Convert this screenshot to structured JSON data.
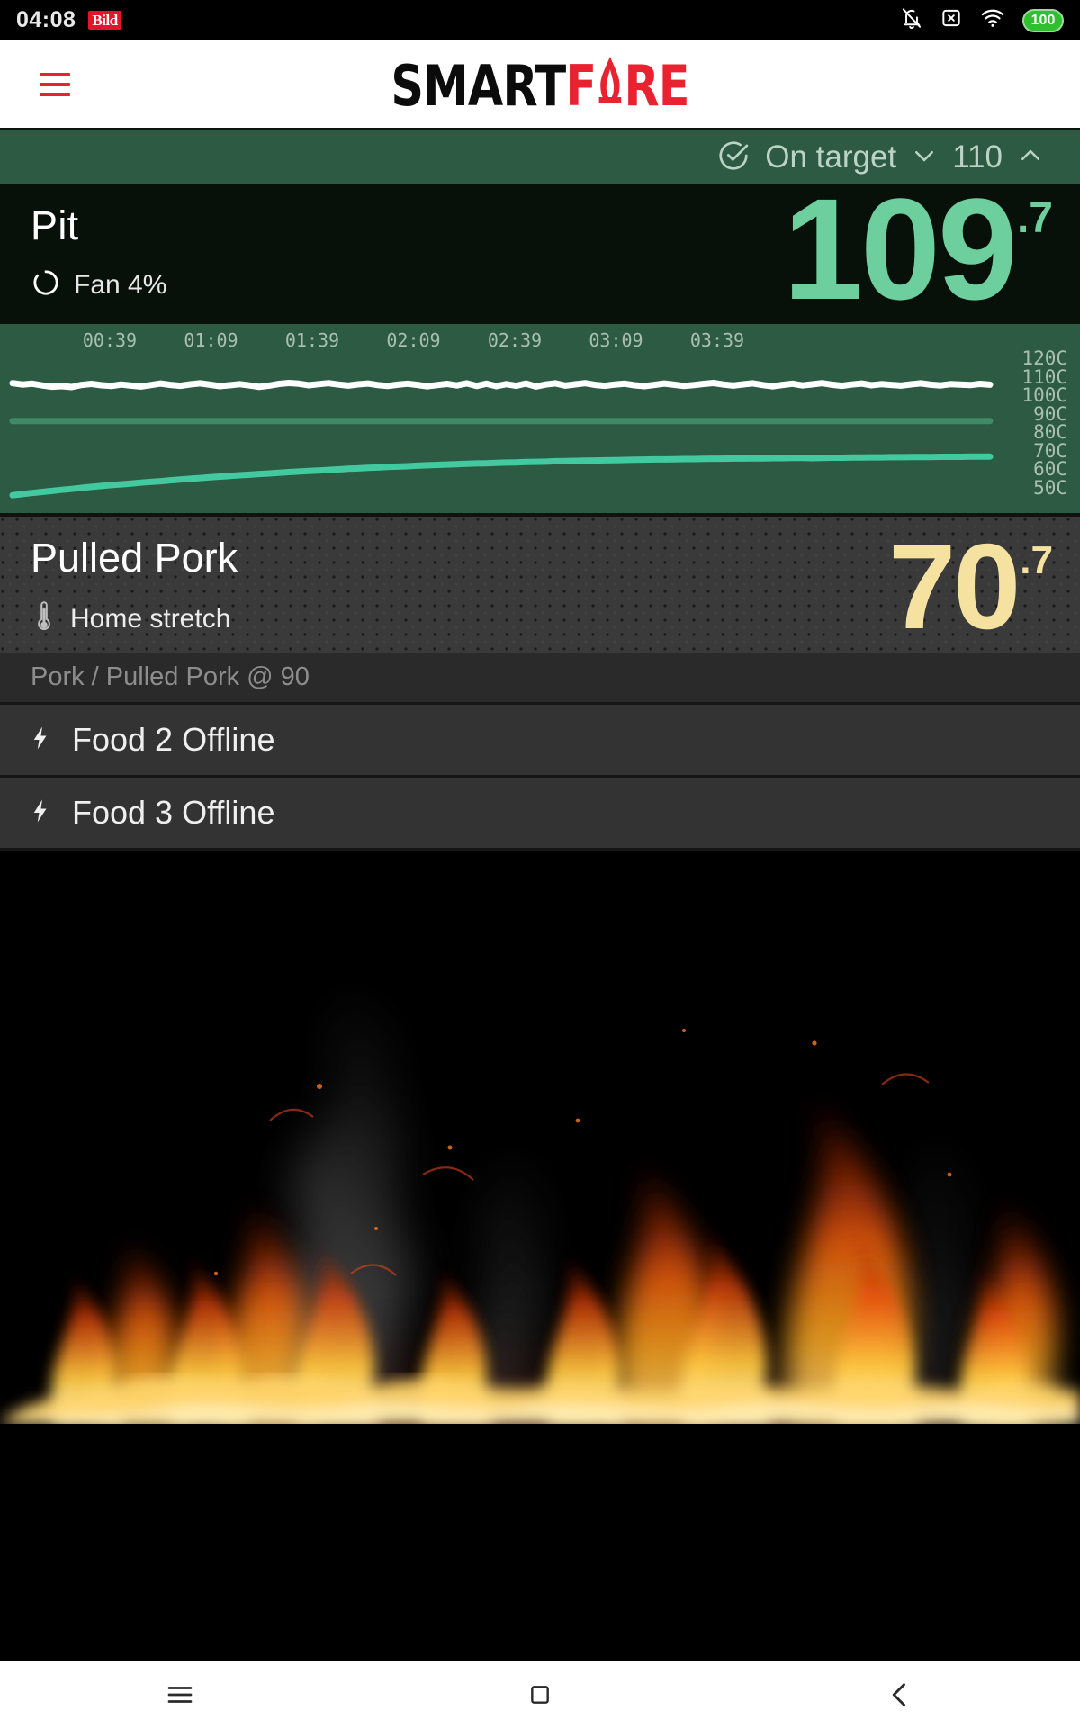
{
  "statusbar": {
    "time": "04:08",
    "app_badge": "Bild",
    "battery": "100",
    "icons": [
      "bell-slash-icon",
      "sim-card-x-icon",
      "wifi-icon",
      "battery-icon"
    ]
  },
  "appbar": {
    "menu_icon": "hamburger-menu-icon",
    "logo_part1": "SMART",
    "logo_part2": "F",
    "logo_part3": "RE",
    "logo_full": "SMARTFIRE",
    "brand_red": "#e8222f",
    "brand_black": "#0b0b0b"
  },
  "target_strip": {
    "status_icon": "check-circle-icon",
    "status_label": "On target",
    "chevron_down": "chevron-down-icon",
    "target_value": "110",
    "chevron_up": "chevron-up-icon"
  },
  "pit": {
    "name": "Pit",
    "fan_icon": "fan-icon",
    "fan_label": "Fan 4%",
    "temp_whole": "109",
    "temp_decimal": ".7",
    "temp_color": "#6ecf9e"
  },
  "food": {
    "name": "Pulled Pork",
    "status_icon": "thermometer-icon",
    "status_label": "Home stretch",
    "temp_whole": "70",
    "temp_decimal": ".7",
    "temp_color": "#f6e2a0",
    "recipe": "Pork / Pulled Pork @ 90"
  },
  "probes": [
    {
      "icon": "bolt-icon",
      "label": "Food 2 Offline"
    },
    {
      "icon": "bolt-icon",
      "label": "Food 3 Offline"
    }
  ],
  "navbar": {
    "recents_icon": "recents-menu-icon",
    "home_icon": "home-square-icon",
    "back_icon": "back-chevron-icon"
  },
  "chart_data": {
    "type": "line",
    "title": "",
    "xlabel": "",
    "ylabel": "",
    "grid": false,
    "legend": false,
    "x_tick_labels": [
      "00:39",
      "01:09",
      "01:39",
      "02:09",
      "02:39",
      "03:09",
      "03:39"
    ],
    "y_tick_labels": [
      "120C",
      "110C",
      "100C",
      "90C",
      "80C",
      "70C",
      "60C",
      "50C"
    ],
    "ylim": [
      45,
      125
    ],
    "units": "C",
    "series": [
      {
        "name": "Pit probe",
        "color": "#ffffff",
        "values": [
          110.5,
          109.8,
          110.2,
          109.3,
          108.6,
          108.9,
          108.4,
          109.6,
          110.1,
          109.4,
          109.0,
          109.8,
          109.2,
          108.7,
          109.5,
          110.3,
          109.6,
          109.1,
          109.9,
          110.4,
          109.7,
          108.9,
          109.4,
          110.0,
          109.3,
          108.5,
          109.2,
          110.1,
          110.6,
          110.2,
          109.4,
          110.0,
          110.5,
          109.8,
          109.2,
          109.9,
          110.3,
          109.5,
          109.0,
          109.7,
          110.2,
          109.6,
          108.8,
          109.5,
          110.1,
          109.3,
          110.4,
          109.0,
          110.2,
          108.9,
          110.0,
          109.1,
          110.3,
          108.7,
          109.8,
          110.4,
          109.2,
          109.9,
          110.5,
          109.6,
          109.1,
          109.8,
          110.2,
          109.4,
          108.9,
          109.6,
          110.3,
          109.7,
          109.0,
          109.5,
          110.1,
          110.6,
          109.8,
          109.2,
          109.9,
          110.4,
          109.5,
          108.8,
          109.6,
          110.2,
          109.3,
          109.9,
          110.5,
          109.7,
          109.1,
          109.8,
          110.3,
          109.4,
          110.0,
          109.6,
          109.2,
          109.9,
          110.4,
          109.7,
          109.3,
          110.0,
          109.8,
          109.5,
          110.1,
          109.7
        ]
      },
      {
        "name": "Pit setpoint",
        "color": "#3f8b68",
        "constant": 90
      },
      {
        "name": "Food probe",
        "color": "#43c9a0",
        "values": [
          49.8,
          50.4,
          51.0,
          51.6,
          52.1,
          52.7,
          53.2,
          53.8,
          54.3,
          54.8,
          55.3,
          55.7,
          56.1,
          56.6,
          57.0,
          57.4,
          57.9,
          58.3,
          58.7,
          59.1,
          59.5,
          59.9,
          60.2,
          60.6,
          60.9,
          61.3,
          61.6,
          62.0,
          62.3,
          62.6,
          62.9,
          63.2,
          63.5,
          63.8,
          64.1,
          64.3,
          64.6,
          64.8,
          65.1,
          65.3,
          65.5,
          65.8,
          66.0,
          66.2,
          66.4,
          66.6,
          66.8,
          67.0,
          67.1,
          67.3,
          67.5,
          67.6,
          67.8,
          67.9,
          68.0,
          68.2,
          68.3,
          68.4,
          68.5,
          68.6,
          68.7,
          68.8,
          68.9,
          69.0,
          69.1,
          69.2,
          69.2,
          69.3,
          69.4,
          69.4,
          69.5,
          69.6,
          69.6,
          69.7,
          69.7,
          69.8,
          69.8,
          69.9,
          69.9,
          70.0,
          70.0,
          69.9,
          70.0,
          70.1,
          70.1,
          70.2,
          70.2,
          70.3,
          70.3,
          70.4,
          70.4,
          70.5,
          70.5,
          70.5,
          70.6,
          70.6,
          70.6,
          70.7,
          70.7,
          70.7
        ]
      }
    ]
  }
}
